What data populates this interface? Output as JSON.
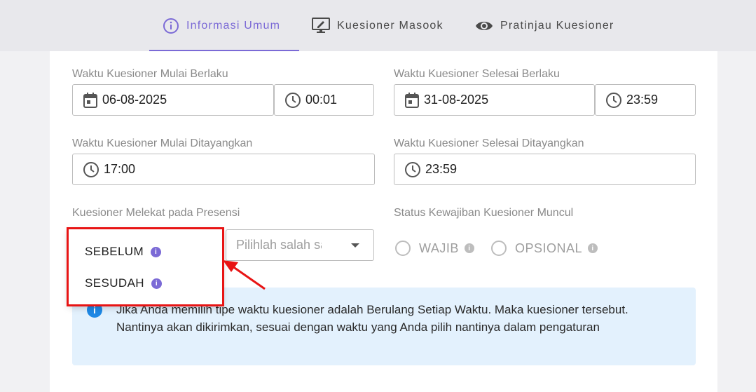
{
  "tabs": [
    {
      "label": "Informasi Umum",
      "icon": "info-circle-icon",
      "active": true
    },
    {
      "label": "Kuesioner Masook",
      "icon": "monitor-edit-icon",
      "active": false
    },
    {
      "label": "Pratinjau Kuesioner",
      "icon": "eye-icon",
      "active": false
    }
  ],
  "form": {
    "start_valid": {
      "label": "Waktu Kuesioner Mulai Berlaku",
      "date": "06-08-2025",
      "time": "00:01"
    },
    "end_valid": {
      "label": "Waktu Kuesioner Selesai Berlaku",
      "date": "31-08-2025",
      "time": "23:59"
    },
    "start_show": {
      "label": "Waktu Kuesioner Mulai Ditayangkan",
      "time": "17:00"
    },
    "end_show": {
      "label": "Waktu Kuesioner Selesai Ditayangkan",
      "time": "23:59"
    },
    "attached": {
      "label": "Kuesioner Melekat pada Presensi",
      "select_placeholder": "Pilihlah salah satu"
    },
    "status": {
      "label": "Status Kewajiban Kuesioner Muncul",
      "options": [
        "WAJIB",
        "OPSIONAL"
      ]
    }
  },
  "dropdown": {
    "options": [
      "SEBELUM",
      "SESUDAH"
    ]
  },
  "alert": {
    "icon": "info-icon",
    "text": "Jika Anda memilih tipe waktu kuesioner adalah Berulang Setiap Waktu. Maka kuesioner tersebut. Nantinya akan dikirimkan, sesuai dengan waktu yang Anda pilih nantinya dalam pengaturan"
  },
  "colors": {
    "accent": "#7b6ad6",
    "highlight": "#e81414",
    "alert_bg": "#e3f1fd",
    "alert_icon": "#1e88e5"
  }
}
